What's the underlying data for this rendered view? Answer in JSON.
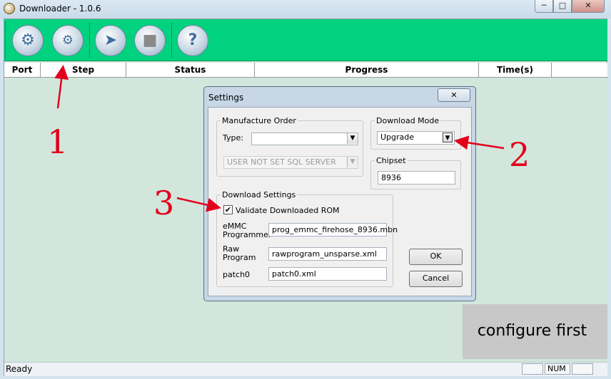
{
  "window": {
    "title": "Downloader - 1.0.6",
    "controls": {
      "min": "─",
      "max": "□",
      "close": "✕"
    }
  },
  "toolbar": {
    "buttons": [
      {
        "name": "settings-gear-icon",
        "glyph": "⚙"
      },
      {
        "name": "advanced-gears-icon",
        "glyph": "⚙"
      },
      {
        "name": "start-arrow-icon",
        "glyph": "➤"
      },
      {
        "name": "stop-icon",
        "glyph": "■"
      },
      {
        "name": "help-icon",
        "glyph": "?"
      }
    ],
    "color": "#00d27f"
  },
  "grid": {
    "columns": [
      "Port",
      "Step",
      "Status",
      "Progress",
      "Time(s)"
    ]
  },
  "status_bar": {
    "text": "Ready",
    "num": "NUM"
  },
  "dialog": {
    "title": "Settings",
    "close": "✕",
    "manufacture_order": {
      "legend": "Manufacture Order",
      "type_label": "Type:",
      "type_value": "",
      "sql_value": "USER NOT SET SQL SERVER"
    },
    "download_mode": {
      "legend": "Download Mode",
      "value": "Upgrade"
    },
    "chipset": {
      "legend": "Chipset",
      "value": "8936"
    },
    "download_settings": {
      "legend": "Download Settings",
      "validate_label": "Validate Downloaded ROM",
      "validate_checked": "✔",
      "emmc_label_1": "eMMC",
      "emmc_label_2": "Programmer",
      "emmc_value": "prog_emmc_firehose_8936.mbn",
      "raw_label_1": "Raw",
      "raw_label_2": "Program",
      "raw_value": "rawprogram_unsparse.xml",
      "patch_label": "patch0",
      "patch_value": "patch0.xml"
    },
    "ok": "OK",
    "cancel": "Cancel"
  },
  "annotations": {
    "n1": "1",
    "n2": "2",
    "n3": "3",
    "overlay_text": "configure first",
    "arrow_color": "#e3001b"
  }
}
